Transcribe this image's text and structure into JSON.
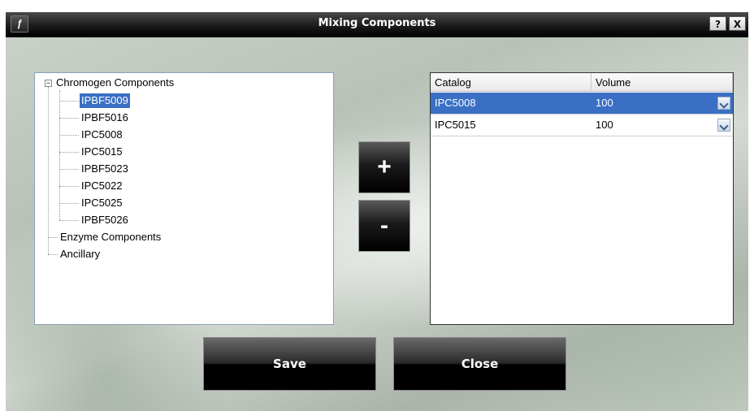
{
  "window": {
    "title": "Mixing Components",
    "help_label": "?",
    "close_label": "X"
  },
  "tree": {
    "root": "Chromogen Components",
    "children": [
      "IPBF5009",
      "IPBF5016",
      "IPC5008",
      "IPC5015",
      "IPBF5023",
      "IPC5022",
      "IPC5025",
      "IPBF5026"
    ],
    "selected": "IPBF5009",
    "siblings": [
      "Enzyme Components",
      "Ancillary"
    ]
  },
  "buttons": {
    "add_label": "+",
    "remove_label": "-",
    "save_label": "Save",
    "close_label": "Close"
  },
  "grid": {
    "columns": [
      "Catalog",
      "Volume"
    ],
    "rows": [
      {
        "catalog": "IPC5008",
        "volume": "100",
        "selected": true
      },
      {
        "catalog": "IPC5015",
        "volume": "100",
        "selected": false
      }
    ]
  },
  "colors": {
    "selection": "#3a6fc4",
    "title_bar": "#1a1a1a"
  }
}
